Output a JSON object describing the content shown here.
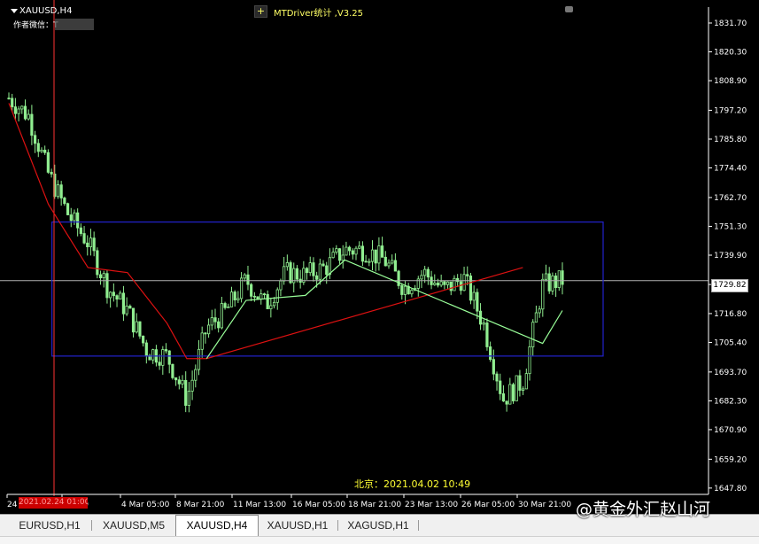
{
  "header": {
    "symbol": "XAUUSD,H4",
    "author_label": "作者微信：T",
    "ea_label": "MTDriver统计 ,V3.25",
    "plus": "+"
  },
  "overlay": {
    "beijing_time": "北京：2021.04.02 10:49",
    "date_badge": "2021.02.24 01:00",
    "watermark": "@黄金外汇赵山河"
  },
  "current_price": "1729.82",
  "tabs": [
    {
      "label": "EURUSD,H1",
      "active": false
    },
    {
      "label": "XAUUSD,M5",
      "active": false
    },
    {
      "label": "XAUUSD,H4",
      "active": true
    },
    {
      "label": "XAUUSD,H1",
      "active": false
    },
    {
      "label": "XAGUSD,H1",
      "active": false
    }
  ],
  "colors": {
    "background": "#000000",
    "candles": "#90ee90",
    "stop_line_red": "#dd1111",
    "stop_line_green": "#99ff99",
    "box": "#2222cc",
    "price_line": "#b0b0b0",
    "axis_text": "#ffffff"
  },
  "chart_data": {
    "type": "line",
    "symbol": "XAUUSD",
    "timeframe": "H4",
    "ylim": [
      1647.8,
      1838.0
    ],
    "y_ticks": [
      "1831.70",
      "1820.30",
      "1808.90",
      "1797.20",
      "1785.80",
      "1774.40",
      "1762.70",
      "1751.30",
      "1739.90",
      "1728.30",
      "1716.80",
      "1705.40",
      "1693.70",
      "1682.30",
      "1670.90",
      "1659.20",
      "1647.80"
    ],
    "x_ticks": [
      "24",
      "1 Mar 13:00",
      "4 Mar 05:00",
      "8 Mar 21:00",
      "11 Mar 13:00",
      "16 Mar 05:00",
      "18 Mar 21:00",
      "23 Mar 13:00",
      "26 Mar 05:00",
      "30 Mar 21:00"
    ],
    "x_tick_visible": [
      "24",
      "13:00",
      "4 Mar 05:00",
      "8 Mar 21:00",
      "11 Mar 13:00",
      "16 Mar 05:00",
      "18 Mar 21:00",
      "23 Mar 13:00",
      "26 Mar 05:00",
      "30 Mar 21:00"
    ],
    "current_price": 1729.82,
    "price_series": [
      {
        "t": "24 Feb",
        "v": 1802
      },
      {
        "t": "25 Feb",
        "v": 1795
      },
      {
        "t": "26 Feb",
        "v": 1772
      },
      {
        "t": "26 Feb",
        "v": 1756
      },
      {
        "t": "1 Mar",
        "v": 1745
      },
      {
        "t": "2 Mar",
        "v": 1727
      },
      {
        "t": "3 Mar",
        "v": 1718
      },
      {
        "t": "4 Mar",
        "v": 1702
      },
      {
        "t": "5 Mar",
        "v": 1700
      },
      {
        "t": "8 Mar",
        "v": 1683
      },
      {
        "t": "9 Mar",
        "v": 1711
      },
      {
        "t": "10 Mar",
        "v": 1718
      },
      {
        "t": "11 Mar",
        "v": 1730
      },
      {
        "t": "12 Mar",
        "v": 1720
      },
      {
        "t": "15 Mar",
        "v": 1733
      },
      {
        "t": "16 Mar",
        "v": 1732
      },
      {
        "t": "17 Mar",
        "v": 1735
      },
      {
        "t": "18 Mar",
        "v": 1742
      },
      {
        "t": "19 Mar",
        "v": 1742
      },
      {
        "t": "22 Mar",
        "v": 1738
      },
      {
        "t": "23 Mar",
        "v": 1727
      },
      {
        "t": "24 Mar",
        "v": 1733
      },
      {
        "t": "25 Mar",
        "v": 1726
      },
      {
        "t": "26 Mar",
        "v": 1731
      },
      {
        "t": "29 Mar",
        "v": 1713
      },
      {
        "t": "30 Mar",
        "v": 1683
      },
      {
        "t": "31 Mar",
        "v": 1690
      },
      {
        "t": "1 Apr",
        "v": 1728
      },
      {
        "t": "2 Apr",
        "v": 1730
      }
    ],
    "stop_line_red": [
      {
        "t": "24 Feb",
        "v": 1800
      },
      {
        "t": "26 Feb",
        "v": 1760
      },
      {
        "t": "1 Mar",
        "v": 1735
      },
      {
        "t": "3 Mar",
        "v": 1733
      },
      {
        "t": "4 Mar",
        "v": 1723
      },
      {
        "t": "5 Mar",
        "v": 1713
      },
      {
        "t": "8 Mar",
        "v": 1699
      },
      {
        "t": "9 Mar",
        "v": 1699
      },
      {
        "t": "31 Mar",
        "v": 1735
      }
    ],
    "stop_line_green": [
      {
        "t": "9 Mar",
        "v": 1699
      },
      {
        "t": "11 Mar",
        "v": 1722
      },
      {
        "t": "16 Mar",
        "v": 1724
      },
      {
        "t": "18 Mar",
        "v": 1738
      },
      {
        "t": "1 Apr",
        "v": 1705
      },
      {
        "t": "2 Apr",
        "v": 1718
      }
    ],
    "range_box": {
      "top": 1753.0,
      "bottom": 1700.0,
      "from": "1 Mar",
      "to": "2 Apr"
    },
    "grid": false
  }
}
